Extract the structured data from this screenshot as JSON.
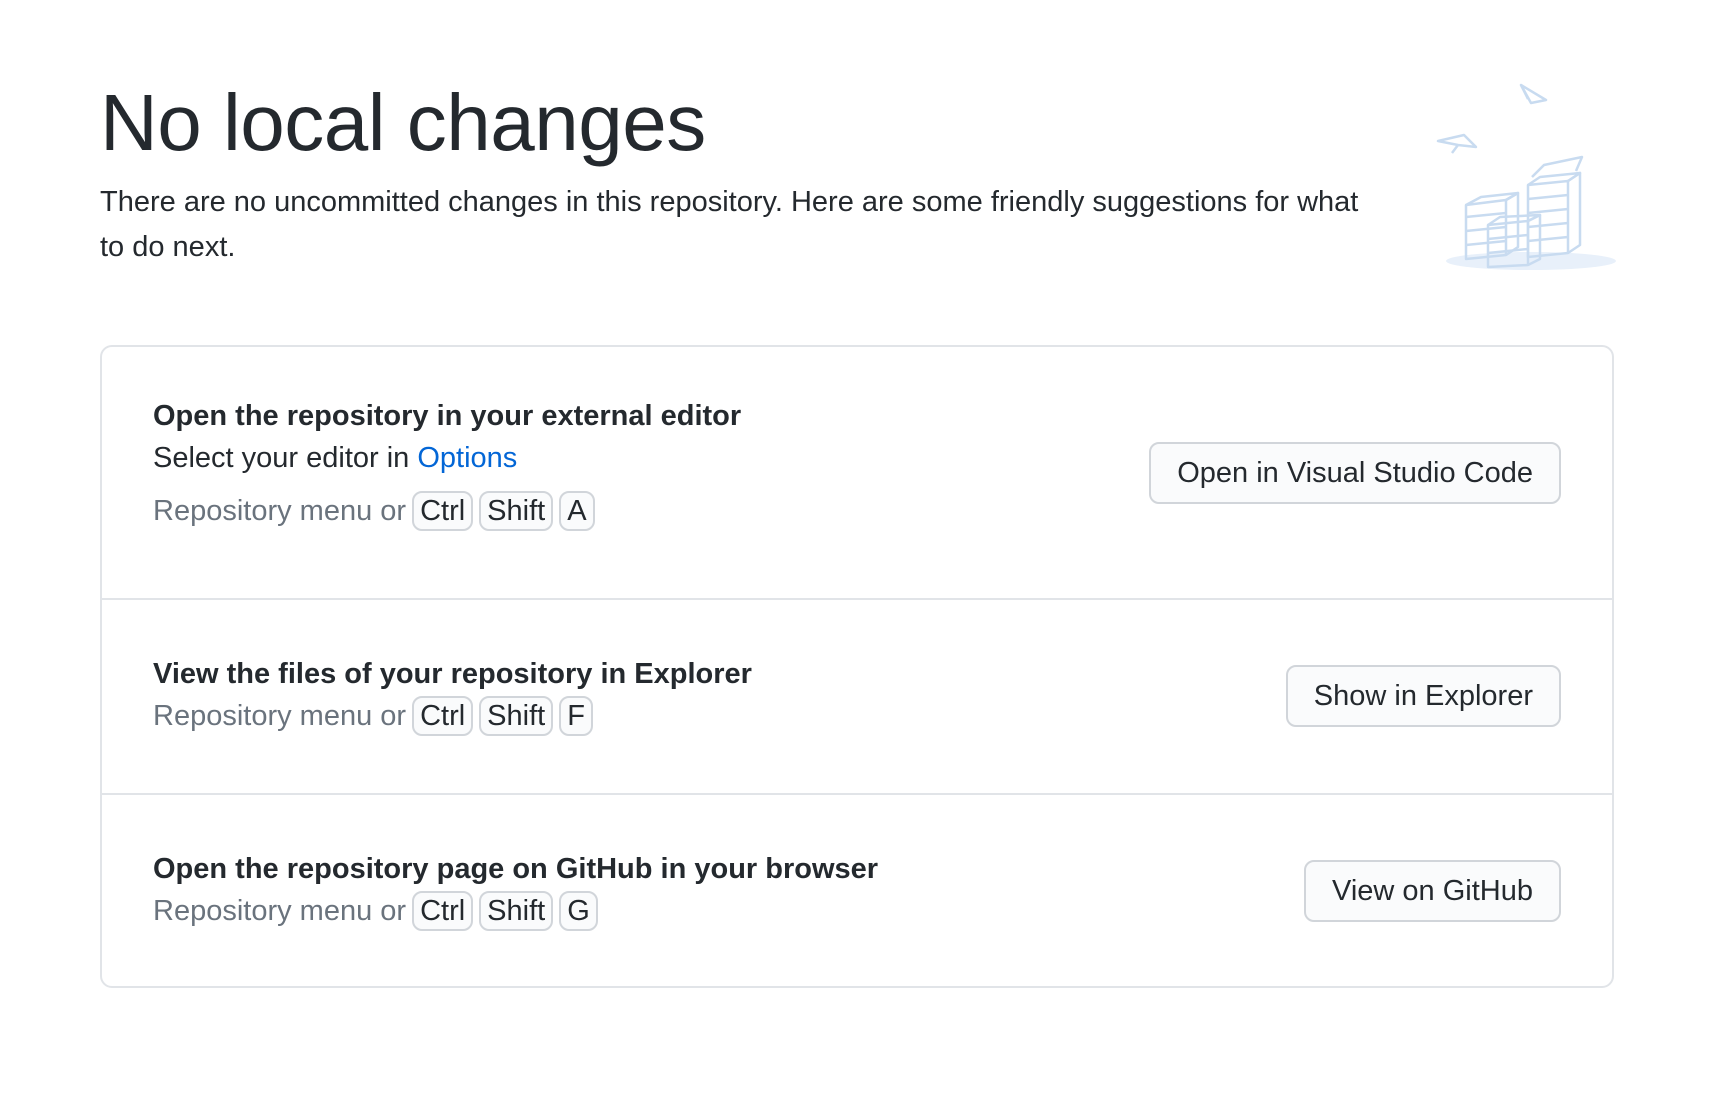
{
  "page": {
    "title": "No local changes",
    "subtitle": "There are no uncommitted changes in this repository. Here are some friendly suggestions for what to do next."
  },
  "suggestions": [
    {
      "title": "Open the repository in your external editor",
      "description_prefix": "Select your editor in ",
      "description_link": "Options",
      "shortcut_prefix": "Repository menu or",
      "keys": [
        "Ctrl",
        "Shift",
        "A"
      ],
      "button_label": "Open in Visual Studio Code"
    },
    {
      "title": "View the files of your repository in Explorer",
      "shortcut_prefix": "Repository menu or",
      "keys": [
        "Ctrl",
        "Shift",
        "F"
      ],
      "button_label": "Show in Explorer"
    },
    {
      "title": "Open the repository page on GitHub in your browser",
      "shortcut_prefix": "Repository menu or",
      "keys": [
        "Ctrl",
        "Shift",
        "G"
      ],
      "button_label": "View on GitHub"
    }
  ],
  "icons": {
    "illustration": "empty-boxes-illustration-icon"
  },
  "colors": {
    "link": "#0366d6",
    "muted_text": "#6a737d",
    "border": "#e1e4e8",
    "illustration": "#c8dbf0"
  }
}
